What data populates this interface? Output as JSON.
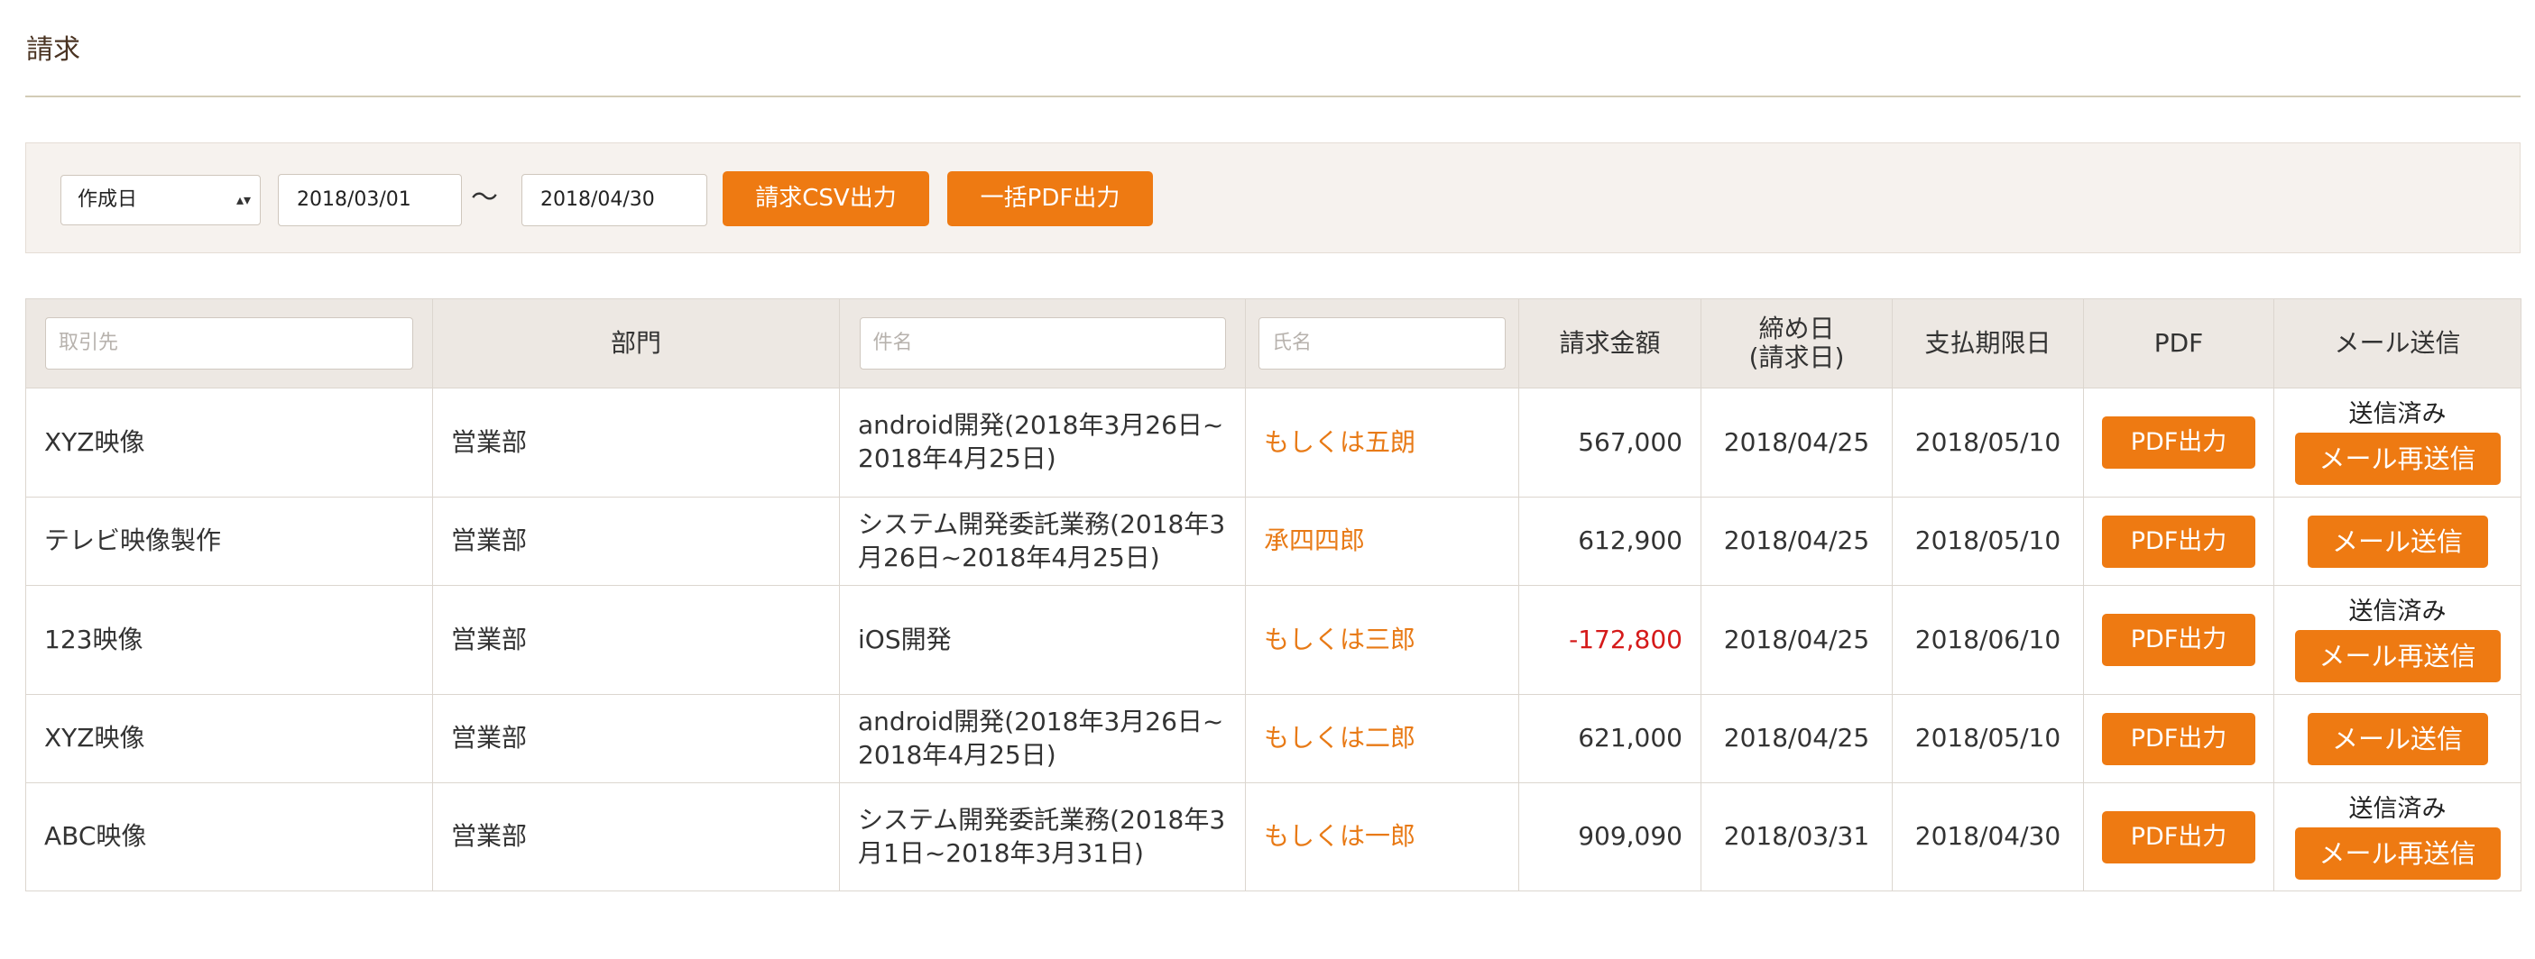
{
  "page": {
    "title": "請求"
  },
  "filter": {
    "select_value": "作成日",
    "date_from": "2018/03/01",
    "separator": "〜",
    "date_to": "2018/04/30",
    "csv_button": "請求CSV出力",
    "pdf_all_button": "一括PDF出力"
  },
  "table": {
    "headers": {
      "client_placeholder": "取引先",
      "department": "部門",
      "subject_placeholder": "件名",
      "person_placeholder": "氏名",
      "amount": "請求金額",
      "closing_line1": "締め日",
      "closing_line2": "(請求日)",
      "due": "支払期限日",
      "pdf": "PDF",
      "mail": "メール送信"
    },
    "rows": [
      {
        "client": "XYZ映像",
        "department": "営業部",
        "subject_l1": "android開発(2018年3月26日~",
        "subject_l2": "2018年4月25日)",
        "person": "もしくは五朗",
        "amount": "567,000",
        "closing": "2018/04/25",
        "due": "2018/05/10",
        "pdf_button": "PDF出力",
        "mail_status": "送信済み",
        "mail_button": "メール再送信"
      },
      {
        "client": "テレビ映像製作",
        "department": "営業部",
        "subject_l1": "システム開発委託業務(2018年3",
        "subject_l2": "月26日~2018年4月25日)",
        "person": "承四四郎",
        "amount": "612,900",
        "closing": "2018/04/25",
        "due": "2018/05/10",
        "pdf_button": "PDF出力",
        "mail_status": "",
        "mail_button": "メール送信"
      },
      {
        "client": "123映像",
        "department": "営業部",
        "subject_l1": "iOS開発",
        "subject_l2": "",
        "person": "もしくは三郎",
        "amount": "-172,800",
        "closing": "2018/04/25",
        "due": "2018/06/10",
        "pdf_button": "PDF出力",
        "mail_status": "送信済み",
        "mail_button": "メール再送信"
      },
      {
        "client": "XYZ映像",
        "department": "営業部",
        "subject_l1": "android開発(2018年3月26日~",
        "subject_l2": "2018年4月25日)",
        "person": "もしくは二郎",
        "amount": "621,000",
        "closing": "2018/04/25",
        "due": "2018/05/10",
        "pdf_button": "PDF出力",
        "mail_status": "",
        "mail_button": "メール送信"
      },
      {
        "client": "ABC映像",
        "department": "営業部",
        "subject_l1": "システム開発委託業務(2018年3",
        "subject_l2": "月1日~2018年3月31日)",
        "person": "もしくは一郎",
        "amount": "909,090",
        "closing": "2018/03/31",
        "due": "2018/04/30",
        "pdf_button": "PDF出力",
        "mail_status": "送信済み",
        "mail_button": "メール再送信"
      }
    ]
  },
  "colors": {
    "accent": "#ee7a12",
    "name_link": "#e87a16",
    "negative": "#d51a1a",
    "header_bg": "#ede8e3",
    "panel_bg": "#f6f2ee"
  }
}
